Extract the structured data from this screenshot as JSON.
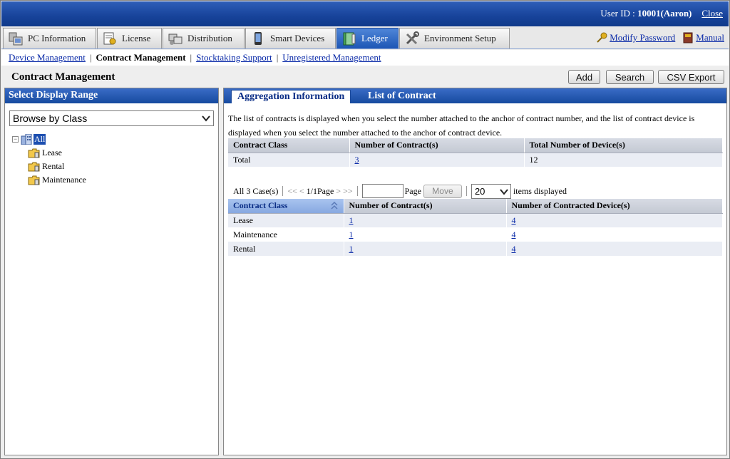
{
  "header": {
    "user_label": "User ID : ",
    "user_id": "10001(Aaron)",
    "close_label": "Close"
  },
  "main_tabs": [
    {
      "label": "PC Information",
      "icon": "pc-icon"
    },
    {
      "label": "License",
      "icon": "license-icon"
    },
    {
      "label": "Distribution",
      "icon": "distribution-icon"
    },
    {
      "label": "Smart Devices",
      "icon": "smartphone-icon"
    },
    {
      "label": "Ledger",
      "icon": "ledger-icon",
      "active": true
    },
    {
      "label": "Environment Setup",
      "icon": "tools-icon"
    }
  ],
  "links": {
    "modify_password": "Modify Password",
    "manual": "Manual"
  },
  "subnav": {
    "device_management": "Device Management",
    "contract_management": "Contract Management",
    "stocktaking_support": "Stocktaking Support",
    "unregistered_management": "Unregistered Management",
    "sep": "|"
  },
  "page": {
    "title": "Contract Management",
    "add_label": "Add",
    "search_label": "Search",
    "csv_export_label": "CSV Export"
  },
  "left_panel": {
    "title": "Select Display Range",
    "browse_select": "Browse by Class",
    "tree_root": "All",
    "tree_toggle": "−",
    "tree_items": [
      "Lease",
      "Rental",
      "Maintenance"
    ]
  },
  "right_panel": {
    "tabs": [
      "Aggregation Information",
      "List of Contract"
    ],
    "description": "The list of contracts is displayed when you select the number attached to the anchor of contract number, and the list of contract device is displayed when you select the number attached to the anchor of contract device.",
    "summary_table": {
      "headers": [
        "Contract Class",
        "Number of Contract(s)",
        "Total Number of Device(s)"
      ],
      "row": [
        "Total",
        "3",
        "12"
      ]
    },
    "pager": {
      "count": "All 3 Case(s)",
      "prev": "<<  <",
      "page_info": "1/1Page",
      "next": ">  >>",
      "sep": "|",
      "page_label": "Page",
      "move_label": "Move",
      "items_value": "20",
      "items_label": "items displayed"
    },
    "detail_table": {
      "headers": [
        "Contract Class",
        "Number of Contract(s)",
        "Number of Contracted Device(s)"
      ],
      "rows": [
        [
          "Lease",
          "1",
          "4"
        ],
        [
          "Maintenance",
          "1",
          "4"
        ],
        [
          "Rental",
          "1",
          "4"
        ]
      ]
    }
  },
  "colors": {
    "header_blue": "#17439a",
    "link_blue": "#0a2aa8",
    "active_tab": "#1d56b5"
  }
}
